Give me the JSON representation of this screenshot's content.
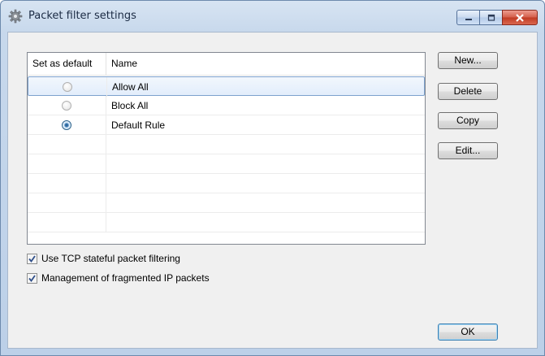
{
  "window": {
    "title": "Packet filter settings"
  },
  "table": {
    "columns": [
      "Set as default",
      "Name"
    ],
    "rows": [
      {
        "name": "Allow All",
        "default": false,
        "selected": true
      },
      {
        "name": "Block All",
        "default": false,
        "selected": false
      },
      {
        "name": "Default Rule",
        "default": true,
        "selected": false
      }
    ]
  },
  "buttons": {
    "new": "New...",
    "delete": "Delete",
    "copy": "Copy",
    "edit": "Edit...",
    "ok": "OK"
  },
  "options": {
    "tcp_stateful": {
      "label": "Use TCP stateful packet filtering",
      "checked": true
    },
    "fragmented_ip": {
      "label": "Management of fragmented IP packets",
      "checked": true
    }
  },
  "colors": {
    "accent": "#3c7fb1",
    "close_button": "#c13a22"
  }
}
